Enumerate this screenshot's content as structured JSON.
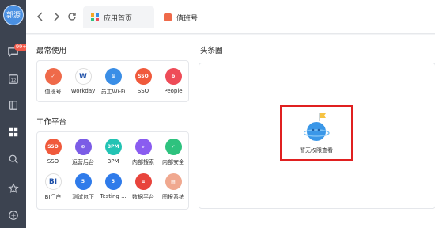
{
  "sidebar": {
    "avatar_text": "郭源",
    "badge": "99+"
  },
  "topbar": {
    "tabs": [
      {
        "label": "应用首页",
        "icon": "grid-icon",
        "color": "#f5a623"
      },
      {
        "label": "值班号",
        "icon": "duty-icon",
        "color": "#ef6a4a"
      }
    ]
  },
  "frequent": {
    "title": "最常使用",
    "apps": [
      {
        "label": "值班号",
        "icon": "duty-icon",
        "color": "#ef6a4a",
        "glyph": "✓"
      },
      {
        "label": "Workday",
        "icon": "workday-icon",
        "color": "#ffffff",
        "glyph": "W"
      },
      {
        "label": "员工Wi-Fi",
        "icon": "wifi-icon",
        "color": "#3a8ee6",
        "glyph": "≋"
      },
      {
        "label": "SSO",
        "icon": "sso-icon",
        "color": "#f05a3c",
        "glyph": "SSO"
      },
      {
        "label": "People",
        "icon": "people-icon",
        "color": "#ee4c58",
        "glyph": "b"
      }
    ]
  },
  "platform": {
    "title": "工作平台",
    "apps": [
      {
        "label": "SSO",
        "icon": "sso-icon",
        "color": "#f05a3c",
        "glyph": "SSO"
      },
      {
        "label": "运营后台",
        "icon": "ops-icon",
        "color": "#7b5ce6",
        "glyph": "⊘"
      },
      {
        "label": "BPM",
        "icon": "bpm-icon",
        "color": "#22c3b4",
        "glyph": "BPM"
      },
      {
        "label": "内部搜索",
        "icon": "search-icon",
        "color": "#8a5cf0",
        "glyph": "⌕"
      },
      {
        "label": "内部安全",
        "icon": "shield-icon",
        "color": "#2ec27e",
        "glyph": "✓"
      },
      {
        "label": "BI门户",
        "icon": "bi-icon",
        "color": "#ffffff",
        "glyph": "BI"
      },
      {
        "label": "测试包下",
        "icon": "html5-icon",
        "color": "#2f7bea",
        "glyph": "5"
      },
      {
        "label": "Testing ...",
        "icon": "html5-icon",
        "color": "#2f7bea",
        "glyph": "5"
      },
      {
        "label": "数据平台",
        "icon": "data-icon",
        "color": "#e8443c",
        "glyph": "≡"
      },
      {
        "label": "图报系统",
        "icon": "report-icon",
        "color": "#f0a88f",
        "glyph": "▤"
      }
    ]
  },
  "headline": {
    "title": "头条圈",
    "empty_text": "暂无权限查看"
  }
}
